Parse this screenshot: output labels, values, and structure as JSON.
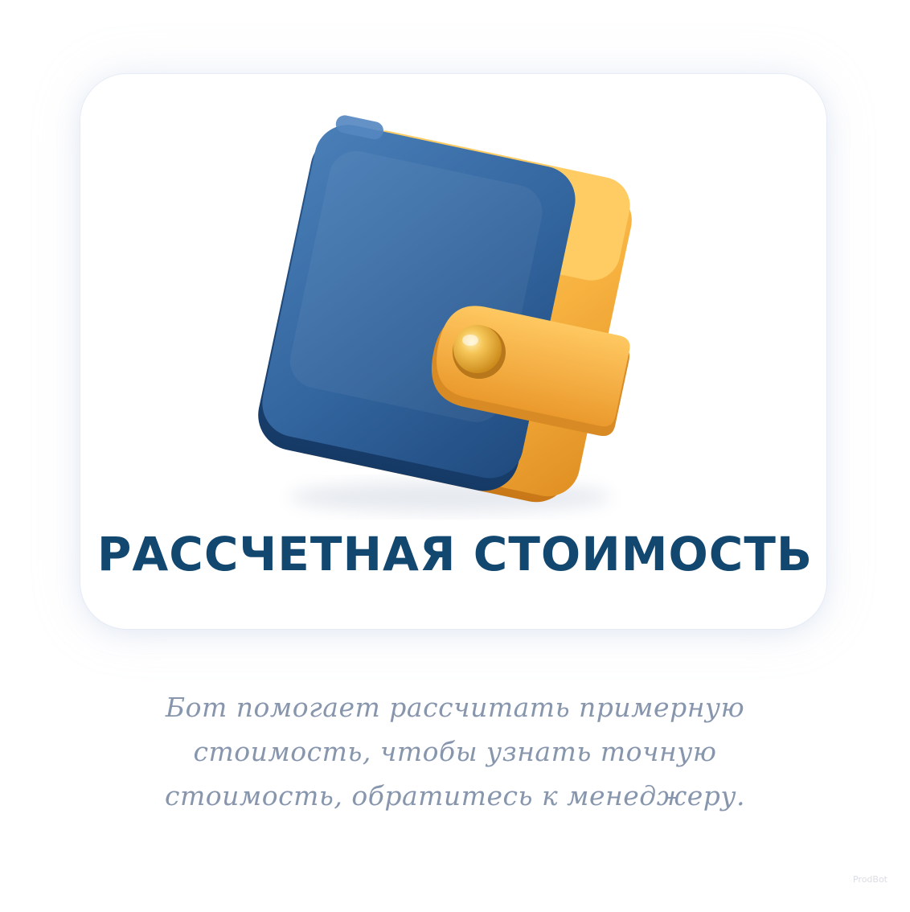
{
  "card": {
    "title": "РАССЧЕТНАЯ СТОИМОСТЬ",
    "icon": "wallet-icon"
  },
  "description": {
    "lines": [
      "Бот помогает рассчитать примерную",
      "стоимость, чтобы узнать точную",
      "стоимость, обратитесь к менеджеру."
    ]
  },
  "colors": {
    "title": "#12476f",
    "description": "#8796ad",
    "wallet_blue": "#2f5e97",
    "wallet_orange": "#f4ad3b",
    "card_background": "#ffffff"
  },
  "watermark": "ProdBot"
}
